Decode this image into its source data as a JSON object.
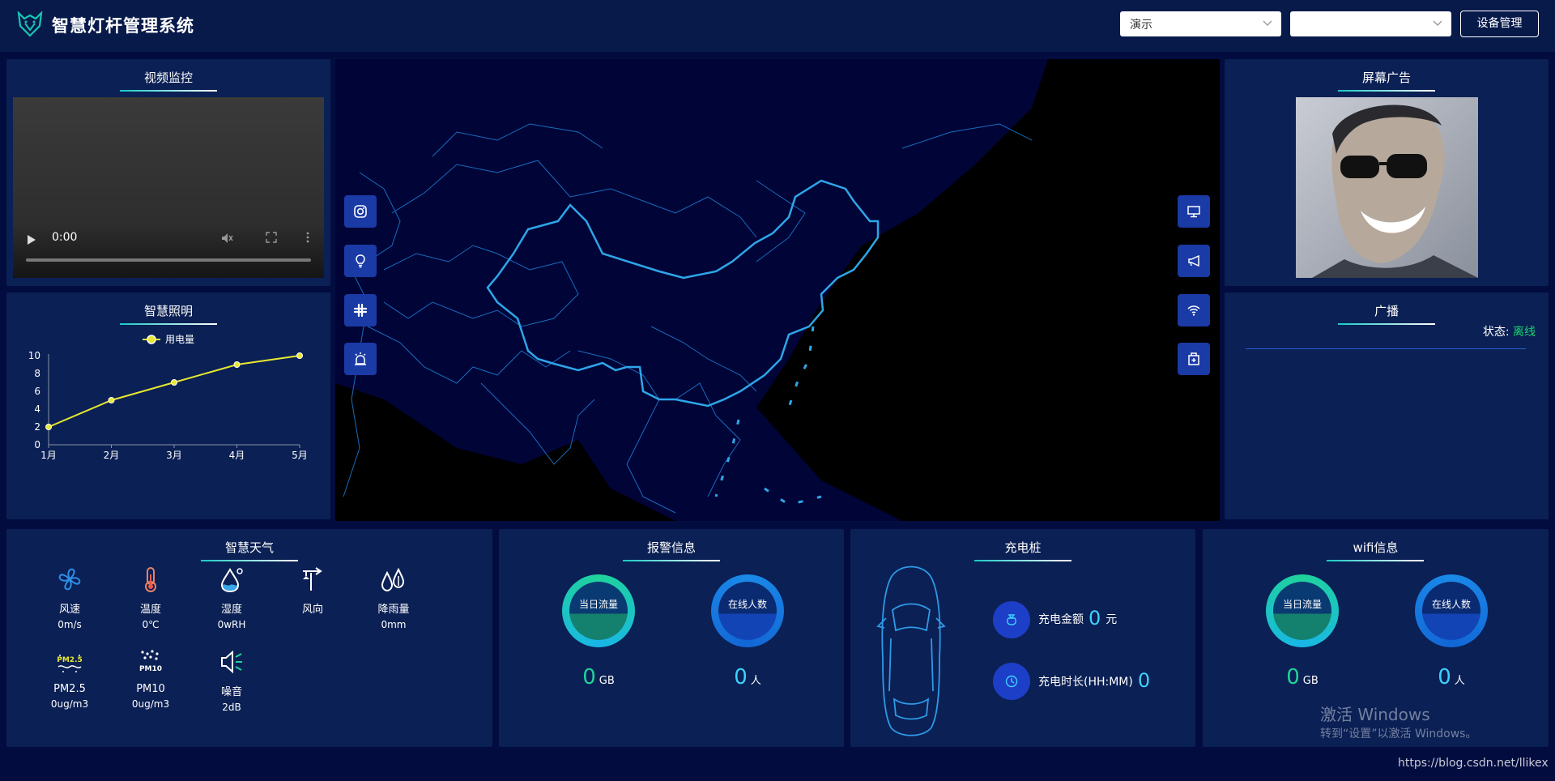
{
  "header": {
    "title": "智慧灯杆管理系统",
    "select1_value": "演示",
    "select2_value": "",
    "device_button": "设备管理"
  },
  "video": {
    "title": "视频监控",
    "time": "0:00"
  },
  "lighting": {
    "title": "智慧照明",
    "chart_data": {
      "type": "line",
      "title": "",
      "categories": [
        "1月",
        "2月",
        "3月",
        "4月",
        "5月"
      ],
      "series": [
        {
          "name": "用电量",
          "values": [
            2,
            5,
            7,
            9,
            10
          ]
        }
      ],
      "ylim": [
        0,
        10
      ],
      "yticks": [
        "0",
        "2",
        "4",
        "6",
        "8",
        "10"
      ],
      "legend": "top-center",
      "color": "#e8e830"
    }
  },
  "map": {
    "left_buttons": [
      "camera-icon",
      "bulb-icon",
      "slack-icon",
      "alarm-icon"
    ],
    "right_buttons": [
      "monitor-icon",
      "megaphone-icon",
      "wifi-icon",
      "charger-icon"
    ]
  },
  "ad": {
    "title": "屏幕广告"
  },
  "broadcast": {
    "title": "广播",
    "status_label": "状态:",
    "status_value": "离线",
    "status_color": "#19d36f"
  },
  "weather": {
    "title": "智慧天气",
    "items": [
      {
        "icon": "fan-icon",
        "label": "风速",
        "value": "0m/s"
      },
      {
        "icon": "thermometer-icon",
        "label": "温度",
        "value": "0℃"
      },
      {
        "icon": "humidity-icon",
        "label": "湿度",
        "value": "0wRH"
      },
      {
        "icon": "wind-direction-icon",
        "label": "风向",
        "value": ""
      },
      {
        "icon": "rain-icon",
        "label": "降雨量",
        "value": "0mm"
      },
      {
        "icon": "pm25-icon",
        "label": "PM2.5",
        "value": "0ug/m3"
      },
      {
        "icon": "pm10-icon",
        "label": "PM10",
        "value": "0ug/m3"
      },
      {
        "icon": "noise-icon",
        "label": "噪音",
        "value": "2dB"
      }
    ]
  },
  "alarm": {
    "title": "报警信息",
    "ring1_label": "当日流量",
    "ring2_label": "在线人数",
    "value1": "0",
    "unit1": "GB",
    "value2": "0",
    "unit2": "人"
  },
  "charging": {
    "title": "充电桩",
    "amount_label": "充电金额",
    "amount_value": "0",
    "amount_unit": "元",
    "duration_label": "充电时长(HH:MM)",
    "duration_value": "0"
  },
  "wifi": {
    "title": "wifi信息",
    "ring1_label": "当日流量",
    "ring2_label": "在线人数",
    "value1": "0",
    "unit1": "GB",
    "value2": "0",
    "unit2": "人"
  },
  "overlay": {
    "activate_title": "激活 Windows",
    "activate_sub": "转到“设置”以激活 Windows。",
    "url": "https://blog.csdn.net/llikex"
  }
}
